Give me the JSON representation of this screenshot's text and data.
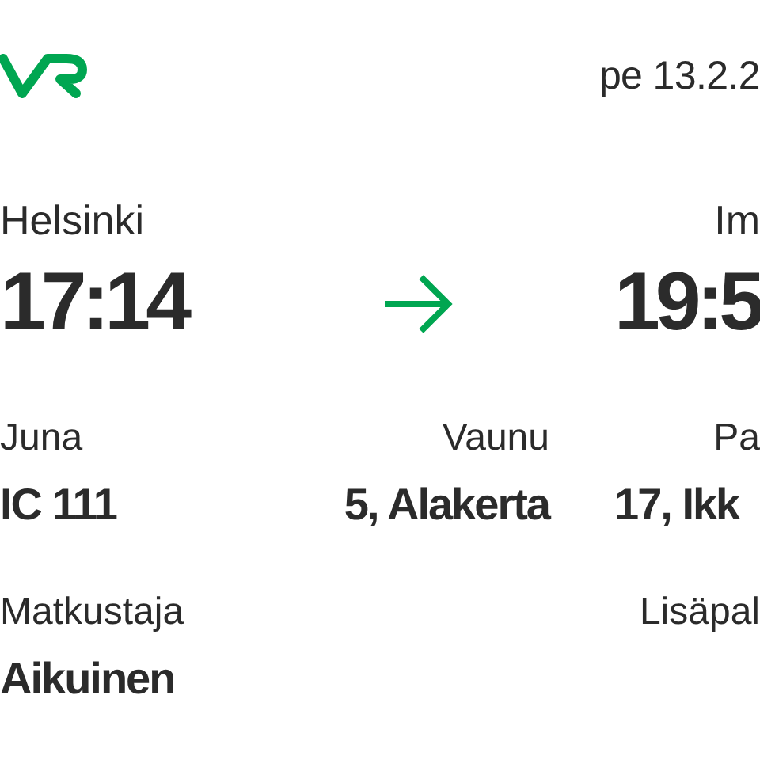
{
  "header": {
    "date": "pe 13.2.2"
  },
  "route": {
    "origin": {
      "station": "Helsinki",
      "time": "17:14"
    },
    "destination": {
      "station": "Im",
      "time": "19:5"
    }
  },
  "details": [
    {
      "label": "Juna",
      "value": "IC 111"
    },
    {
      "label": "Vaunu",
      "value": "5, Alakerta"
    },
    {
      "label": "Pa",
      "value": "17, Ikk"
    }
  ],
  "passenger": {
    "label": "Matkustaja",
    "value": "Aikuinen"
  },
  "extras": {
    "label": "Lisäpal"
  }
}
